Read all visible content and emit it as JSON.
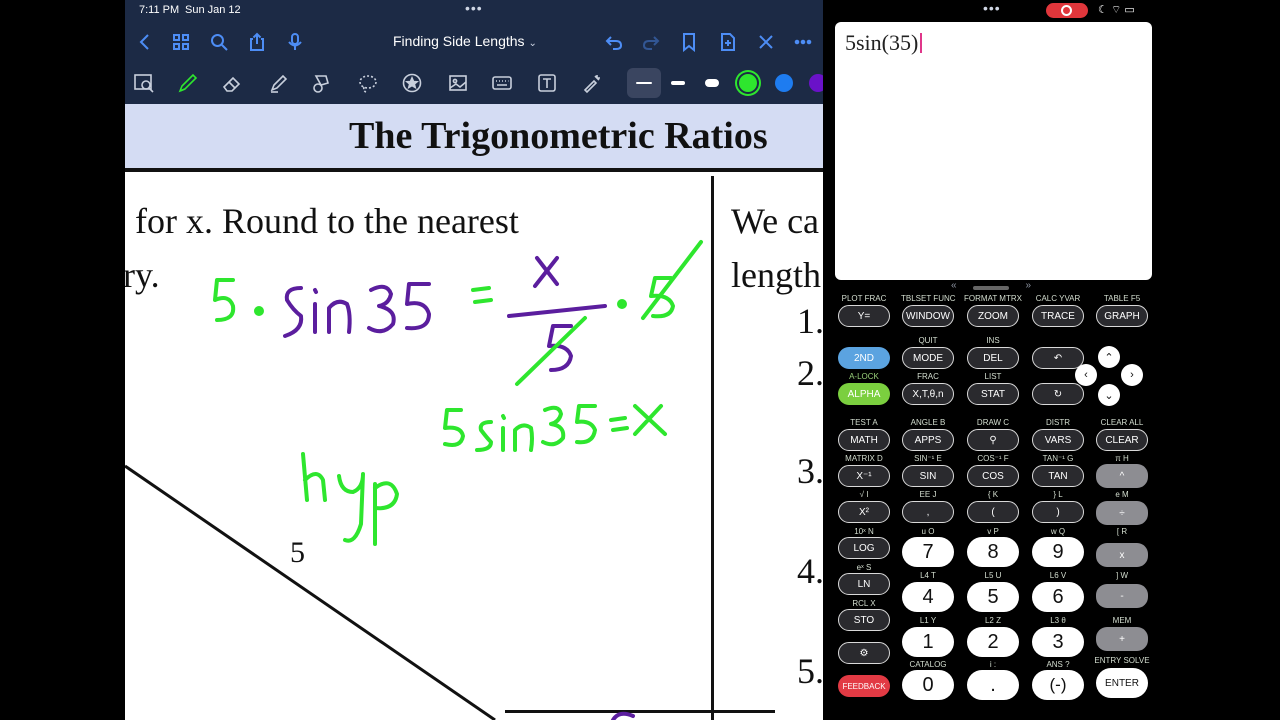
{
  "status": {
    "time": "7:11 PM",
    "date": "Sun Jan 12"
  },
  "notes": {
    "title": "Finding Side Lengths",
    "banner_title": "The Trigonometric Ratios",
    "text_line1": "for x. Round to the nearest",
    "text_line2": "ry.",
    "right_line1": "We ca",
    "right_line2": "length",
    "numbers": [
      "1.",
      "2.",
      "3.",
      "4.",
      "5."
    ],
    "figure_side_label": "5",
    "ink_colors": {
      "green": "#2ee62e",
      "purple": "#5b1e9e"
    },
    "pen_colors": [
      "#2ee62e",
      "#1e7cf0",
      "#6a12c8"
    ]
  },
  "calc": {
    "expression": "5sin(35)",
    "pager_left": "«",
    "pager_right": "»",
    "rows": {
      "top_labels": [
        "PLOT FRAC",
        "TBLSET FUNC",
        "FORMAT MTRX",
        "CALC YVAR",
        "TABLE F5"
      ],
      "top_keys": [
        "Y=",
        "WINDOW",
        "ZOOM",
        "TRACE",
        "GRAPH"
      ],
      "row2_labels": [
        "QUIT",
        "INS"
      ],
      "row2_keys": [
        "2ND",
        "MODE",
        "DEL"
      ],
      "row3_labels": [
        "A-LOCK",
        "FRAC",
        "LIST"
      ],
      "row3_keys": [
        "ALPHA",
        "X,T,θ,n",
        "STAT"
      ],
      "row4_labels": [
        "TEST A",
        "ANGLE B",
        "DRAW C",
        "DISTR",
        "CLEAR ALL"
      ],
      "row4_keys": [
        "MATH",
        "APPS",
        "Q",
        "VARS",
        "CLEAR"
      ],
      "row5_labels": [
        "MATRIX D",
        "SIN⁻¹ E",
        "COS⁻¹ F",
        "TAN⁻¹ G",
        "π H"
      ],
      "row5_keys": [
        "X⁻¹",
        "SIN",
        "COS",
        "TAN",
        "^"
      ],
      "row6_labels": [
        "√ I",
        "EE J",
        "{ K",
        "} L",
        "e M"
      ],
      "row6_keys": [
        "X²",
        ",",
        "(",
        ")",
        "÷"
      ],
      "row7_labels": [
        "10ˣ N",
        "u O",
        "v P",
        "w Q",
        "[ R"
      ],
      "row7_keys": [
        "LOG",
        "7",
        "8",
        "9",
        "x"
      ],
      "row8_labels": [
        "eˣ S",
        "L4 T",
        "L5 U",
        "L6 V",
        "] W"
      ],
      "row8_keys": [
        "LN",
        "4",
        "5",
        "6",
        "-"
      ],
      "row9_labels": [
        "RCL X",
        "L1 Y",
        "L2 Z",
        "L3 θ",
        "MEM"
      ],
      "row9_keys": [
        "STO",
        "1",
        "2",
        "3",
        "+"
      ],
      "row10_labels": [
        "CATALOG",
        "i :",
        "ANS ?",
        "ENTRY SOLVE"
      ],
      "row10_keys": [
        "FEEDBACK",
        "0",
        ".",
        "(-)",
        "ENTER"
      ]
    }
  }
}
